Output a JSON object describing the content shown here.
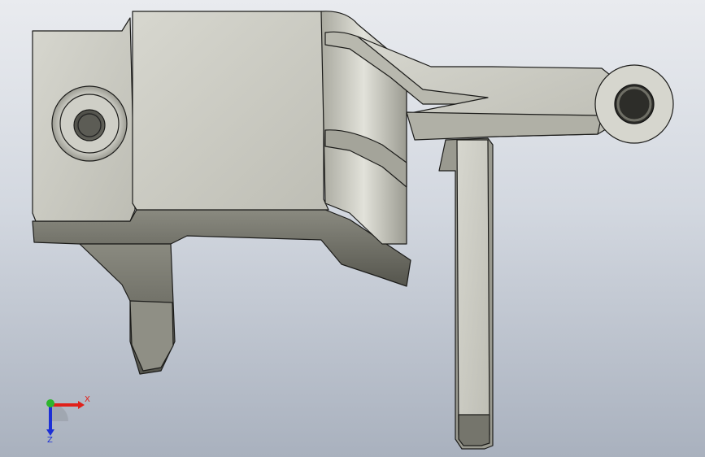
{
  "viewport": {
    "background_top": "#e9ebef",
    "background_bottom": "#a9b1be"
  },
  "model": {
    "face_color": "#c9c9c1",
    "shadow_color": "#6d6d63",
    "edge_color": "#1c1c1a"
  },
  "triad": {
    "x_label": "X",
    "z_label": "Z",
    "x_color": "#e0201a",
    "y_color": "#2db52d",
    "z_color": "#1c2fd6"
  }
}
